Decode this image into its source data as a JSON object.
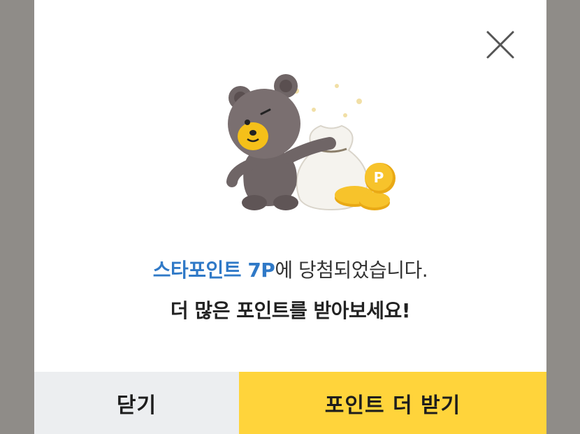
{
  "dialog": {
    "highlight": "스타포인트 7P",
    "message_rest": "에 당첨되었습니다.",
    "message2": "더 많은 포인트를 받아보세요!",
    "close_button_label": "닫기",
    "more_points_button_label": "포인트 더 받기",
    "coin_letter": "P"
  },
  "colors": {
    "highlight": "#2f79c7",
    "primary_button": "#ffd43b",
    "secondary_button": "#eceef0",
    "backdrop": "#8f8c88"
  },
  "icons": [
    "close-icon",
    "bear-with-money-bag-illustration"
  ]
}
